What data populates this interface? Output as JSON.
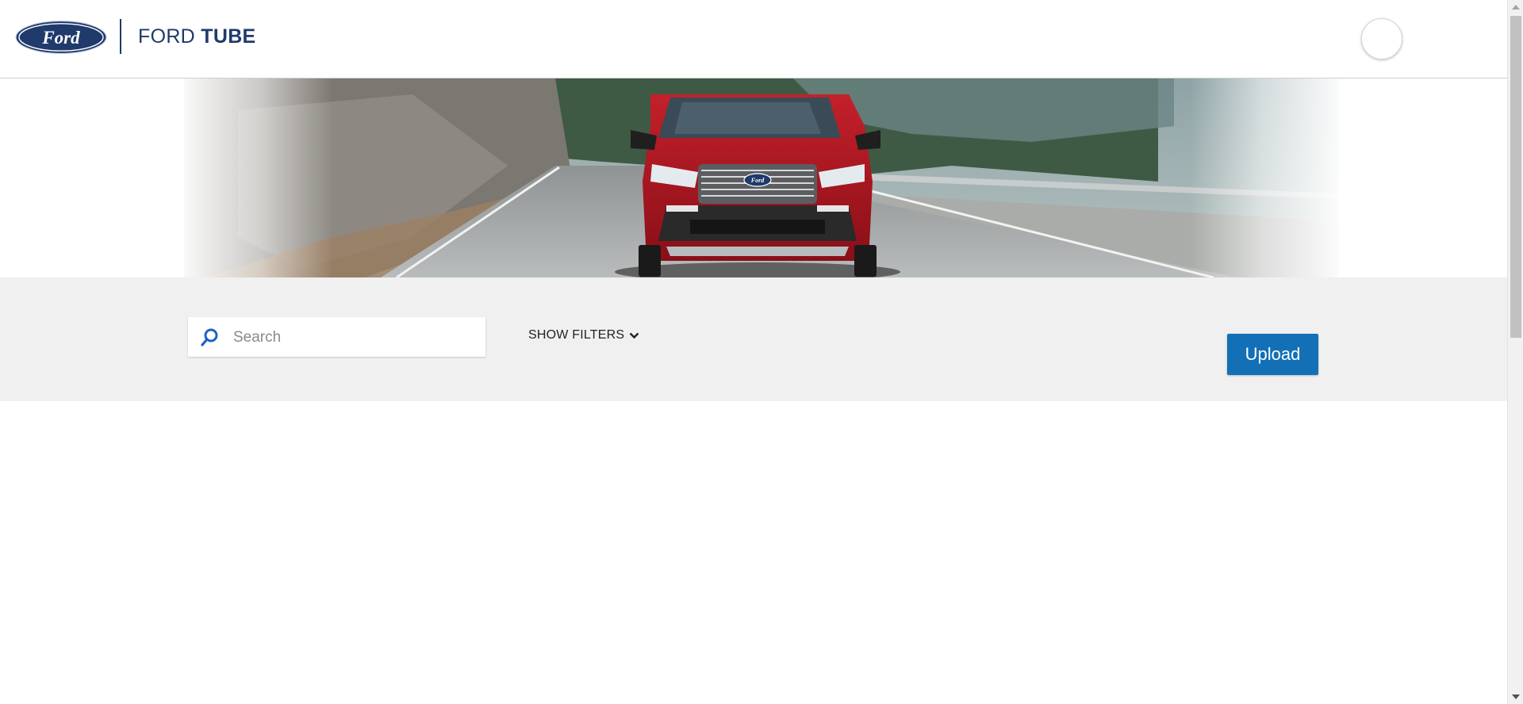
{
  "header": {
    "logo_text": "Ford",
    "brand_light": "FORD ",
    "brand_bold": "TUBE"
  },
  "hero": {
    "image_alt": "Red Ford SUV driving on a mountain road",
    "grille_badge_text": "Ford"
  },
  "toolbar": {
    "search_placeholder": "Search",
    "filters_label": "SHOW FILTERS",
    "upload_label": "Upload"
  },
  "icons": {
    "search": "search-icon",
    "filters_chevron": "chevron-down-icon",
    "avatar": "user-avatar"
  },
  "colors": {
    "brand_navy": "#1f3a6b",
    "upload_blue": "#1370b7",
    "toolbar_bg": "#f0f0f0",
    "search_icon_blue": "#1a62c6"
  }
}
